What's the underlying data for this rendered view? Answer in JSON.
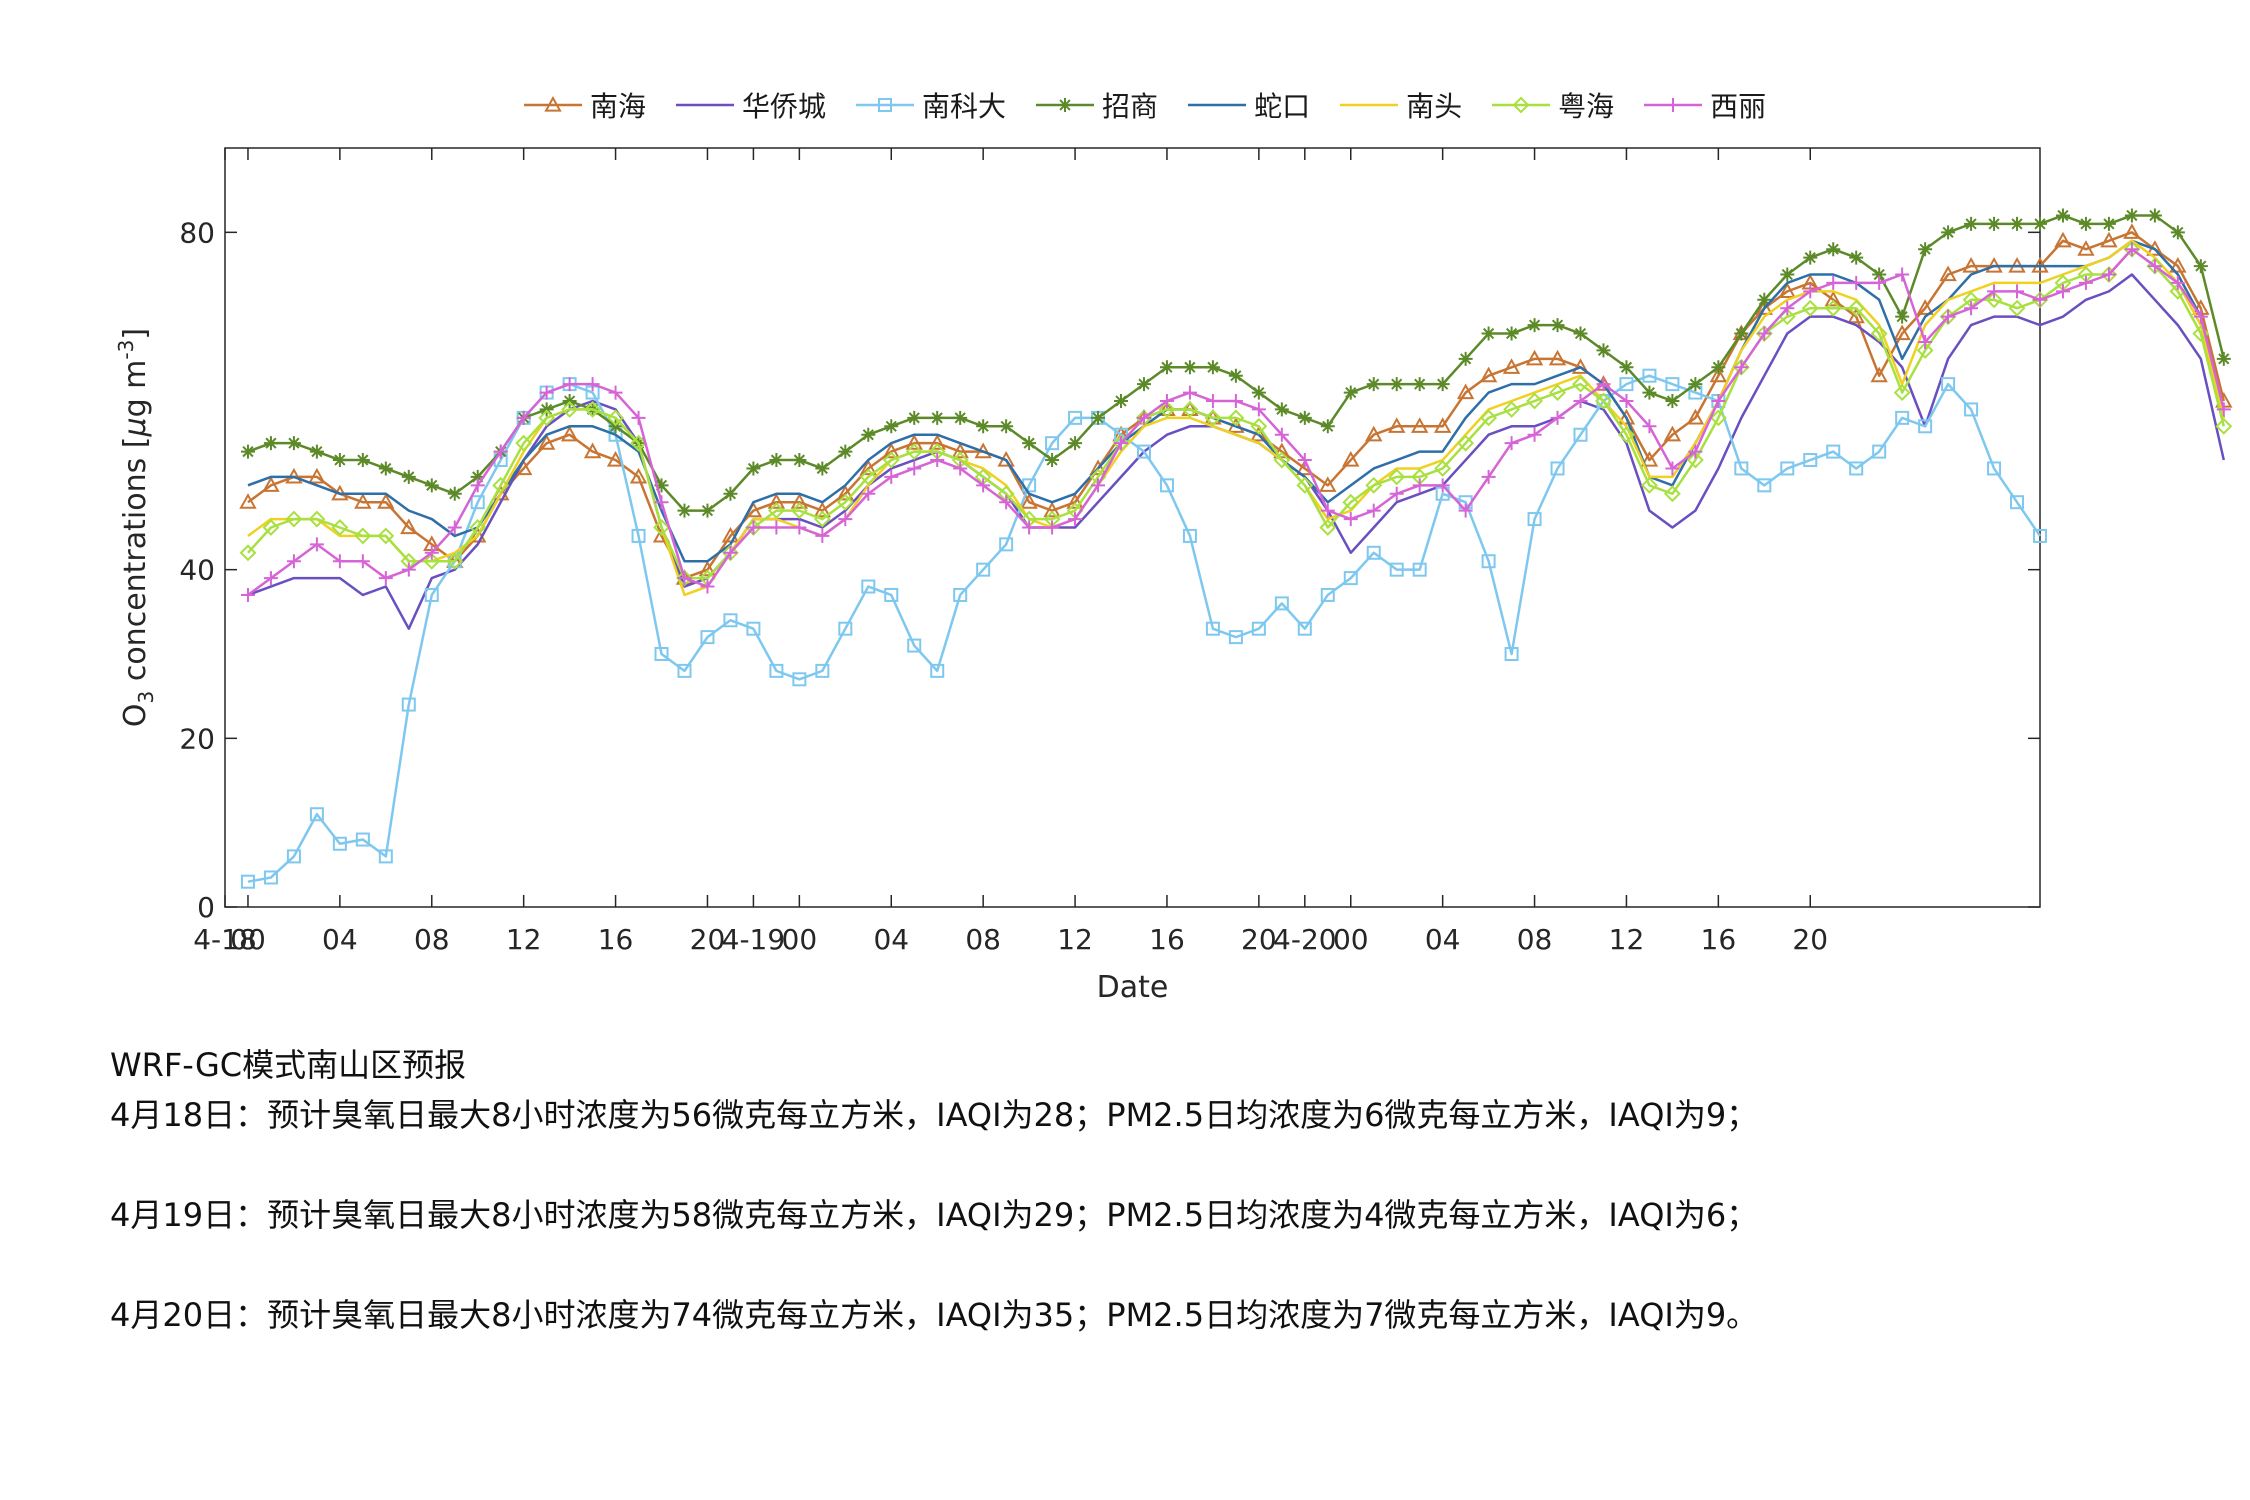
{
  "chart_data": {
    "type": "line",
    "xlabel": "Date",
    "ylabel_parts": {
      "pre": "O",
      "sub": "3",
      "mid": " concentrations [",
      "mu": "μ",
      "g": "g m",
      "sup": "-3",
      "post": "]"
    },
    "ylim": [
      0,
      90
    ],
    "yticks": [
      0,
      20,
      40,
      80
    ],
    "x_tick_labels": [
      "4-18",
      "00",
      "04",
      "08",
      "12",
      "16",
      "20",
      "4-19",
      "00",
      "04",
      "08",
      "12",
      "16",
      "20",
      "4-20",
      "00",
      "04",
      "08",
      "12",
      "16",
      "20"
    ],
    "x_tick_hours": [
      -1,
      0,
      4,
      8,
      12,
      16,
      20,
      22,
      24,
      28,
      32,
      36,
      40,
      44,
      46,
      48,
      52,
      56,
      60,
      64,
      68
    ],
    "x_range_hours": [
      -1,
      78
    ],
    "legend_position": "top",
    "grid": false,
    "series": [
      {
        "name": "南海",
        "color": "#c87533",
        "marker": "triangle",
        "values": [
          48,
          50,
          51,
          51,
          49,
          48,
          48,
          45,
          43,
          41,
          44,
          49,
          52,
          55,
          56,
          54,
          53,
          51,
          44,
          39,
          40,
          44,
          47,
          48,
          48,
          47,
          49,
          52,
          54,
          55,
          55,
          54,
          54,
          53,
          48,
          47,
          48,
          52,
          56,
          58,
          59,
          59,
          58,
          57,
          56,
          54,
          52,
          50,
          53,
          56,
          57,
          57,
          57,
          61,
          63,
          64,
          65,
          65,
          64,
          62,
          58,
          53,
          56,
          58,
          63,
          68,
          71,
          73,
          74,
          72,
          70,
          63,
          68,
          71,
          75,
          76,
          76,
          76,
          76,
          79,
          78,
          79,
          80,
          78,
          76,
          71,
          60
        ]
      },
      {
        "name": "华侨城",
        "color": "#6a4fc0",
        "marker": "none",
        "values": [
          37,
          38,
          39,
          39,
          39,
          37,
          38,
          33,
          39,
          40,
          43,
          48,
          53,
          57,
          59,
          60,
          59,
          55,
          45,
          38,
          39,
          42,
          46,
          46,
          46,
          45,
          47,
          50,
          52,
          53,
          54,
          53,
          51,
          49,
          45,
          45,
          45,
          48,
          51,
          54,
          56,
          57,
          57,
          56,
          55,
          53,
          51,
          47,
          42,
          45,
          48,
          49,
          50,
          53,
          56,
          57,
          57,
          58,
          60,
          59,
          55,
          47,
          45,
          47,
          52,
          58,
          63,
          68,
          70,
          70,
          69,
          67,
          64,
          57,
          65,
          69,
          70,
          70,
          69,
          70,
          72,
          73,
          75,
          72,
          69,
          65,
          53
        ]
      },
      {
        "name": "南科大",
        "color": "#7ec8f0",
        "marker": "square",
        "values": [
          3,
          3.5,
          6,
          11,
          7.5,
          8,
          6,
          24,
          37,
          41,
          48,
          53,
          58,
          61,
          62,
          61,
          56,
          44,
          30,
          28,
          32,
          34,
          33,
          28,
          27,
          28,
          33,
          38,
          37,
          31,
          28,
          37,
          40,
          43,
          50,
          55,
          58,
          58,
          56,
          54,
          50,
          44,
          33,
          32,
          33,
          36,
          33,
          37,
          39,
          42,
          40,
          40,
          49,
          48,
          41,
          30,
          46,
          52,
          56,
          60,
          62,
          63,
          62,
          61,
          60,
          52,
          50,
          52,
          53,
          54,
          52,
          54,
          58,
          57,
          62,
          59,
          52,
          48,
          44
        ]
      },
      {
        "name": "招商",
        "color": "#5c8a28",
        "marker": "asterisk",
        "values": [
          54,
          55,
          55,
          54,
          53,
          53,
          52,
          51,
          50,
          49,
          51,
          54,
          58,
          59,
          60,
          59,
          57,
          55,
          50,
          47,
          47,
          49,
          52,
          53,
          53,
          52,
          54,
          56,
          57,
          58,
          58,
          58,
          57,
          57,
          55,
          53,
          55,
          58,
          60,
          62,
          64,
          64,
          64,
          63,
          61,
          59,
          58,
          57,
          61,
          62,
          62,
          62,
          62,
          65,
          68,
          68,
          69,
          69,
          68,
          66,
          64,
          61,
          60,
          62,
          64,
          68,
          72,
          75,
          77,
          78,
          77,
          75,
          70,
          78,
          80,
          81,
          81,
          81,
          81,
          82,
          81,
          81,
          82,
          82,
          80,
          76,
          65
        ]
      },
      {
        "name": "蛇口",
        "color": "#2e6fa8",
        "marker": "none",
        "values": [
          50,
          51,
          51,
          50,
          49,
          49,
          49,
          47,
          46,
          44,
          45,
          49,
          53,
          56,
          57,
          57,
          56,
          54,
          47,
          41,
          41,
          43,
          48,
          49,
          49,
          48,
          50,
          53,
          55,
          56,
          56,
          55,
          54,
          53,
          49,
          48,
          49,
          52,
          55,
          57,
          59,
          59,
          58,
          57,
          56,
          53,
          51,
          48,
          50,
          52,
          53,
          54,
          54,
          58,
          61,
          62,
          62,
          63,
          64,
          62,
          58,
          51,
          50,
          55,
          60,
          66,
          71,
          74,
          75,
          75,
          74,
          72,
          65,
          70,
          72,
          75,
          76,
          76,
          76,
          76,
          76,
          77,
          79,
          78,
          75,
          70,
          58
        ]
      },
      {
        "name": "南头",
        "color": "#f0d020",
        "marker": "none",
        "values": [
          44,
          46,
          46,
          46,
          44,
          44,
          44,
          41,
          41,
          42,
          44,
          49,
          54,
          58,
          59,
          59,
          58,
          55,
          45,
          37,
          38,
          42,
          46,
          46,
          45,
          44,
          46,
          50,
          53,
          54,
          54,
          53,
          52,
          50,
          46,
          45,
          46,
          50,
          54,
          57,
          58,
          58,
          57,
          56,
          55,
          53,
          50,
          46,
          47,
          50,
          52,
          52,
          53,
          56,
          59,
          60,
          61,
          62,
          63,
          60,
          57,
          51,
          51,
          55,
          60,
          66,
          70,
          72,
          73,
          73,
          72,
          69,
          62,
          69,
          72,
          73,
          74,
          74,
          74,
          75,
          76,
          77,
          79,
          77,
          74,
          69,
          58
        ]
      },
      {
        "name": "粤海",
        "color": "#a8e040",
        "marker": "diamond",
        "values": [
          42,
          45,
          46,
          46,
          45,
          44,
          44,
          41,
          41,
          41,
          45,
          50,
          55,
          58,
          59,
          59,
          58,
          55,
          45,
          39,
          39,
          42,
          45,
          47,
          47,
          46,
          48,
          51,
          53,
          54,
          54,
          53,
          51,
          49,
          46,
          46,
          47,
          51,
          55,
          58,
          59,
          59,
          58,
          58,
          57,
          53,
          50,
          45,
          48,
          50,
          51,
          51,
          52,
          55,
          58,
          59,
          60,
          61,
          62,
          60,
          56,
          50,
          49,
          53,
          58,
          64,
          68,
          70,
          71,
          71,
          71,
          68,
          61,
          66,
          70,
          72,
          72,
          71,
          72,
          74,
          75,
          75,
          78,
          76,
          73,
          68,
          57
        ]
      },
      {
        "name": "西丽",
        "color": "#d664d6",
        "marker": "plus",
        "values": [
          37,
          39,
          41,
          43,
          41,
          41,
          39,
          40,
          42,
          45,
          50,
          54,
          58,
          61,
          62,
          62,
          61,
          58,
          48,
          39,
          38,
          42,
          45,
          45,
          45,
          44,
          46,
          49,
          51,
          52,
          53,
          52,
          50,
          48,
          45,
          45,
          46,
          50,
          55,
          58,
          60,
          61,
          60,
          60,
          59,
          56,
          53,
          47,
          46,
          47,
          49,
          50,
          50,
          47,
          51,
          55,
          56,
          58,
          60,
          62,
          60,
          57,
          52,
          54,
          60,
          64,
          68,
          71,
          73,
          74,
          74,
          74,
          75,
          67,
          70,
          71,
          73,
          73,
          72,
          73,
          74,
          75,
          78,
          76,
          74,
          70,
          59
        ]
      }
    ]
  },
  "forecast": {
    "title": "WRF-GC模式南山区预报",
    "lines": [
      "4月18日：预计臭氧日最大8小时浓度为56微克每立方米，IAQI为28；PM2.5日均浓度为6微克每立方米，IAQI为9；",
      "4月19日：预计臭氧日最大8小时浓度为58微克每立方米，IAQI为29；PM2.5日均浓度为4微克每立方米，IAQI为6；",
      "4月20日：预计臭氧日最大8小时浓度为74微克每立方米，IAQI为35；PM2.5日均浓度为7微克每立方米，IAQI为9。"
    ]
  }
}
